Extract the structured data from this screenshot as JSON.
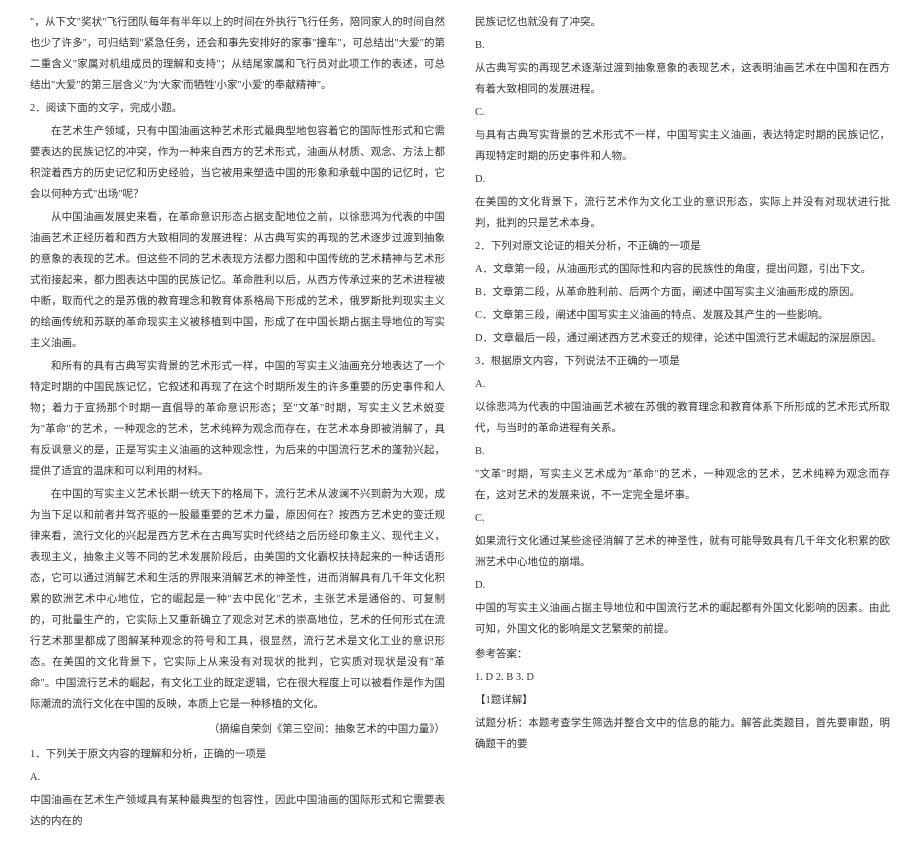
{
  "left": {
    "p0": "\"，从下文\"奖状\"飞行团队每年有半年以上的时间在外执行飞行任务，陪同家人的时间自然也少了许多\"，可归结到\"紧急任务，还会和事先安排好的家事\"撞车\"，可总结出\"大爱\"的第二重含义\"家属对机组成员的理解和支持\"；从结尾家属和飞行员对此项工作的表述，可总结出\"大爱\"的第三层含义\"为'大家'而牺牲'小家''小爱'的奉献精神\"。",
    "sectionHeader": "2．阅读下面的文字，完成小题。",
    "p1": "在艺术生产领域，只有中国油画这种艺术形式最典型地包容着它的国际性形式和它需要表达的民族记忆的冲突，作为一种来自西方的艺术形式，油画从材质、观念、方法上都积淀着西方的历史记忆和历史经验，当它被用来塑造中国的形象和承载中国的记忆时，它会以何种方式\"出场\"呢？",
    "p2": "从中国油画发展史来看，在革命意识形态占据支配地位之前，以徐悲鸿为代表的中国油画艺术正经历着和西方大致相同的发展进程：从古典写实的再现的艺术逐步过渡到抽象的意象的表现的艺术。但这些不同的艺术表现方法都力图和中国传统的艺术精神与艺术形式衔接起来，都力图表达中国的民族记忆。革命胜利以后，从西方传承过来的艺术进程被中断，取而代之的是苏俄的教育理念和教育体系格局下形成的艺术，俄罗斯批判现实主义的绘画传统和苏联的革命现实主义被移植到中国，形成了在中国长期占据主导地位的写实主义油画。",
    "p3": "和所有的具有古典写实背景的艺术形式一样，中国的写实主义油画充分地表达了一个特定时期的中国民族记忆，它叙述和再现了在这个时期所发生的许多重要的历史事件和人物；着力于宣扬那个时期一直倡导的革命意识形态；至\"文革\"时期，写实主义艺术蜕变为\"革命\"的艺术，一种观念的艺术，艺术纯粹为观念而存在，在艺术本身即被消解了，具有反讽意义的是，正是写实主义油画的这种观念性，为后来的中国流行艺术的蓬勃兴起，提供了适宜的温床和可以利用的材料。",
    "p4": "在中国的写实主义艺术长期一统天下的格局下，流行艺术从波澜不兴到蔚为大观，成为当下足以和前者并驾齐驱的一股最重要的艺术力量，原因何在？按西方艺术史的变迁规律来看，流行文化的兴起是西方艺术在古典写实时代终结之后历经印象主义、现代主义，表现主义，抽象主义等不同的艺术发展阶段后，由美国的文化霸权扶持起来的一种话语形态，它可以通过消解艺术和生活的界限来消解艺术的神圣性，进而消解具有几千年文化积累的欧洲艺术中心地位，它的崛起是一种\"去中民化\"艺术，主张艺术是通俗的、可复制的，可批量生产的，它实际上又重新确立了观念对艺术的崇高地位，艺术的任何形式在流行艺术那里都成了图解某种观念的符号和工具，很显然，流行艺术是文化工业的意识形态。在美国的文化背景下，它实际上从来没有对现状的批判，它实质对现状是没有\"革命\"。中国流行艺术的崛起，有文化工业的既定逻辑，它在很大程度上可以被看作是作为国际潮流的流行文化在中国的反映，本质上它是一种移植的文化。",
    "source": "（摘编自荣剑《第三空间：抽象艺术的中国力量》）",
    "q1Label": "1．下列关于原文内容的理解和分析，正确的一项是",
    "optA_label": "A.",
    "optA_text": "中国油画在艺术生产领域具有某种最典型的包容性，因此中国油画的国际形式和它需要表达的内在的"
  },
  "right": {
    "optA_cont": "民族记忆也就没有了冲突。",
    "optB_label": "B.",
    "optB_text": "从古典写实的再现艺术逐渐过渡到抽象意象的表现艺术，这表明油画艺术在中国和在西方有着大致相同的发展进程。",
    "optC_label": "C.",
    "optC_text": "与具有古典写实背景的艺术形式不一样，中国写实主义油画，表达特定时期的民族记忆，再现特定时期的历史事件和人物。",
    "optD_label": "D.",
    "optD_text": "在美国的文化背景下，流行艺术作为文化工业的意识形态，实际上并没有对现状进行批判，批判的只是艺术本身。",
    "q2Label": "2．下列对原文论证的相关分析，不正确的一项是",
    "q2A": "A．文章第一段，从油画形式的国际性和内容的民族性的角度，提出问题，引出下文。",
    "q2B": "B．文章第二段，从革命胜利前、后两个方面，阐述中国写实主义油画形成的原因。",
    "q2C": "C．文章第三段，阐述中国写实主义油画的特点、发展及其产生的一些影响。",
    "q2D": "D．文章最后一段，通过阐述西方艺术变迁的规律，论述中国流行艺术崛起的深层原因。",
    "q3Label": "3．根据原文内容，下列说法不正确的一项是",
    "q3A_label": "A.",
    "q3A_text": "以徐悲鸿为代表的中国油画艺术被在苏俄的教育理念和教育体系下所形成的艺术形式所取代，与当时的革命进程有关系。",
    "q3B_label": "B.",
    "q3B_text": "\"文革\"时期，写实主义艺术成为\"革命\"的艺术，一种观念的艺术，艺术纯粹为观念而存在，这对艺术的发展来说，不一定完全是坏事。",
    "q3C_label": "C.",
    "q3C_text": "如果流行文化通过某些途径消解了艺术的神圣性，就有可能导致具有几千年文化积累的欧洲艺术中心地位的崩塌。",
    "q3D_label": "D.",
    "q3D_text": "中国的写实主义油画占据主导地位和中国流行艺术的崛起都有外国文化影响的因素。由此可知，外国文化的影响是文艺繁荣的前提。",
    "answerHeader": "参考答案：",
    "answers": "1. D   2. B   3. D",
    "analysisHeader": "【1题详解】",
    "analysisText": "试题分析：本题考查学生筛选并整合文中的信息的能力。解答此类题目，首先要审题，明确题干的要"
  }
}
